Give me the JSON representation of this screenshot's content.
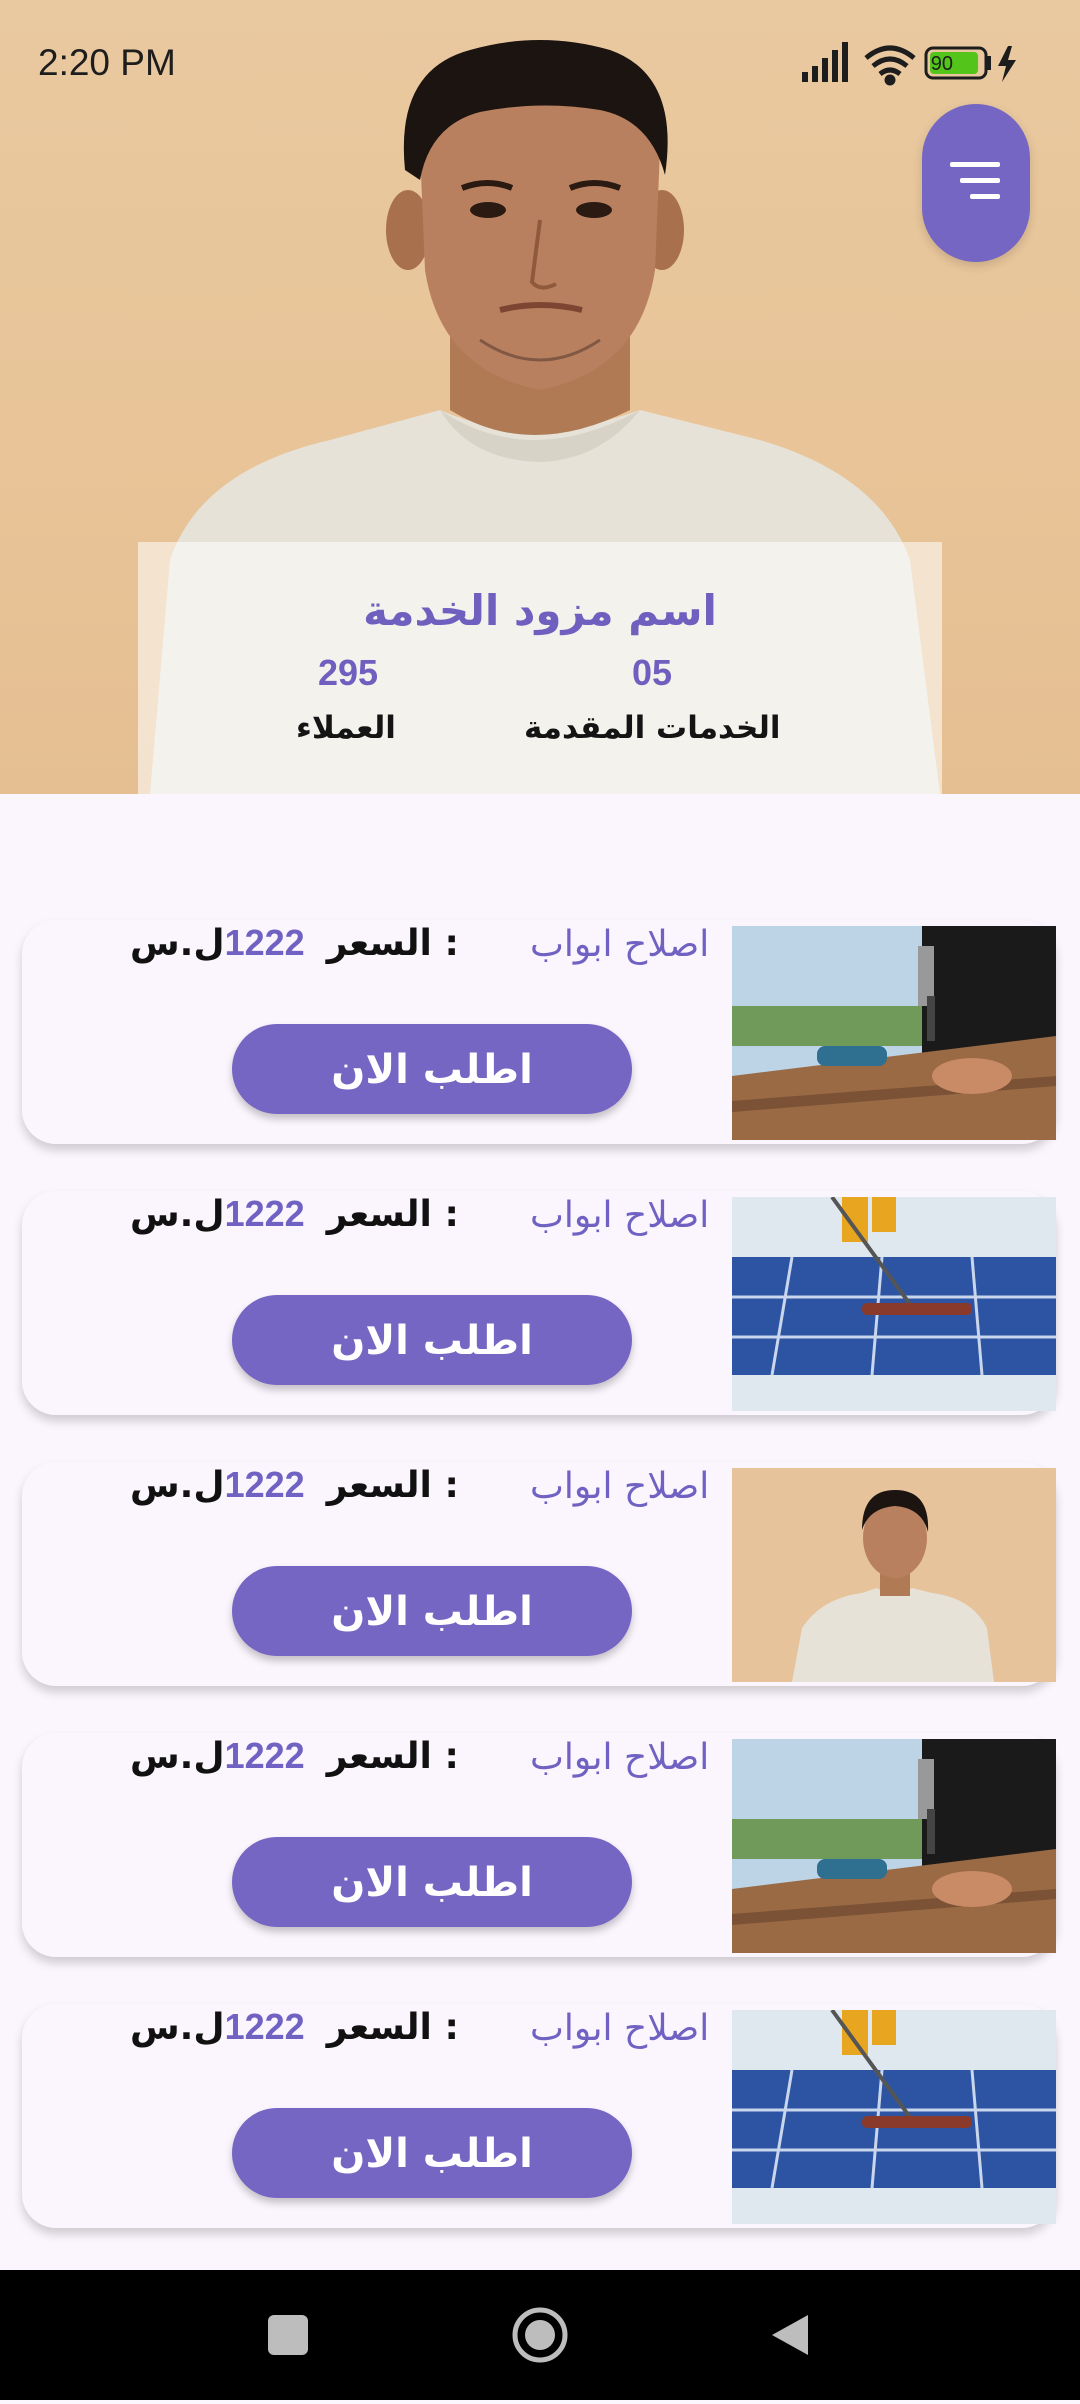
{
  "status_bar": {
    "time": "2:20 PM",
    "battery": "90"
  },
  "provider": {
    "name": "اسم مزود الخدمة",
    "services_count": "05",
    "services_label": "الخدمات المقدمة",
    "clients_count": "295",
    "clients_label": "العملاء"
  },
  "services": [
    {
      "title": "اصلاح ابواب",
      "price_label": "السعر :",
      "price": "1222",
      "currency": "ل.س",
      "button": "اطلب الان",
      "image": "carpenter-hammer-image"
    },
    {
      "title": "اصلاح ابواب",
      "price_label": "السعر :",
      "price": "1222",
      "currency": "ل.س",
      "button": "اطلب الان",
      "image": "solar-panel-cleaning-image"
    },
    {
      "title": "اصلاح ابواب",
      "price_label": "السعر :",
      "price": "1222",
      "currency": "ل.س",
      "button": "اطلب الان",
      "image": "provider-portrait-image"
    },
    {
      "title": "اصلاح ابواب",
      "price_label": "السعر :",
      "price": "1222",
      "currency": "ل.س",
      "button": "اطلب الان",
      "image": "carpenter-hammer-image"
    },
    {
      "title": "اصلاح ابواب",
      "price_label": "السعر :",
      "price": "1222",
      "currency": "ل.س",
      "button": "اطلب الان",
      "image": "solar-panel-cleaning-image"
    }
  ],
  "colors": {
    "accent": "#7566c3",
    "accent_text": "#6f5fbf",
    "background": "#fbf6fd",
    "hero": "#e8c498"
  }
}
